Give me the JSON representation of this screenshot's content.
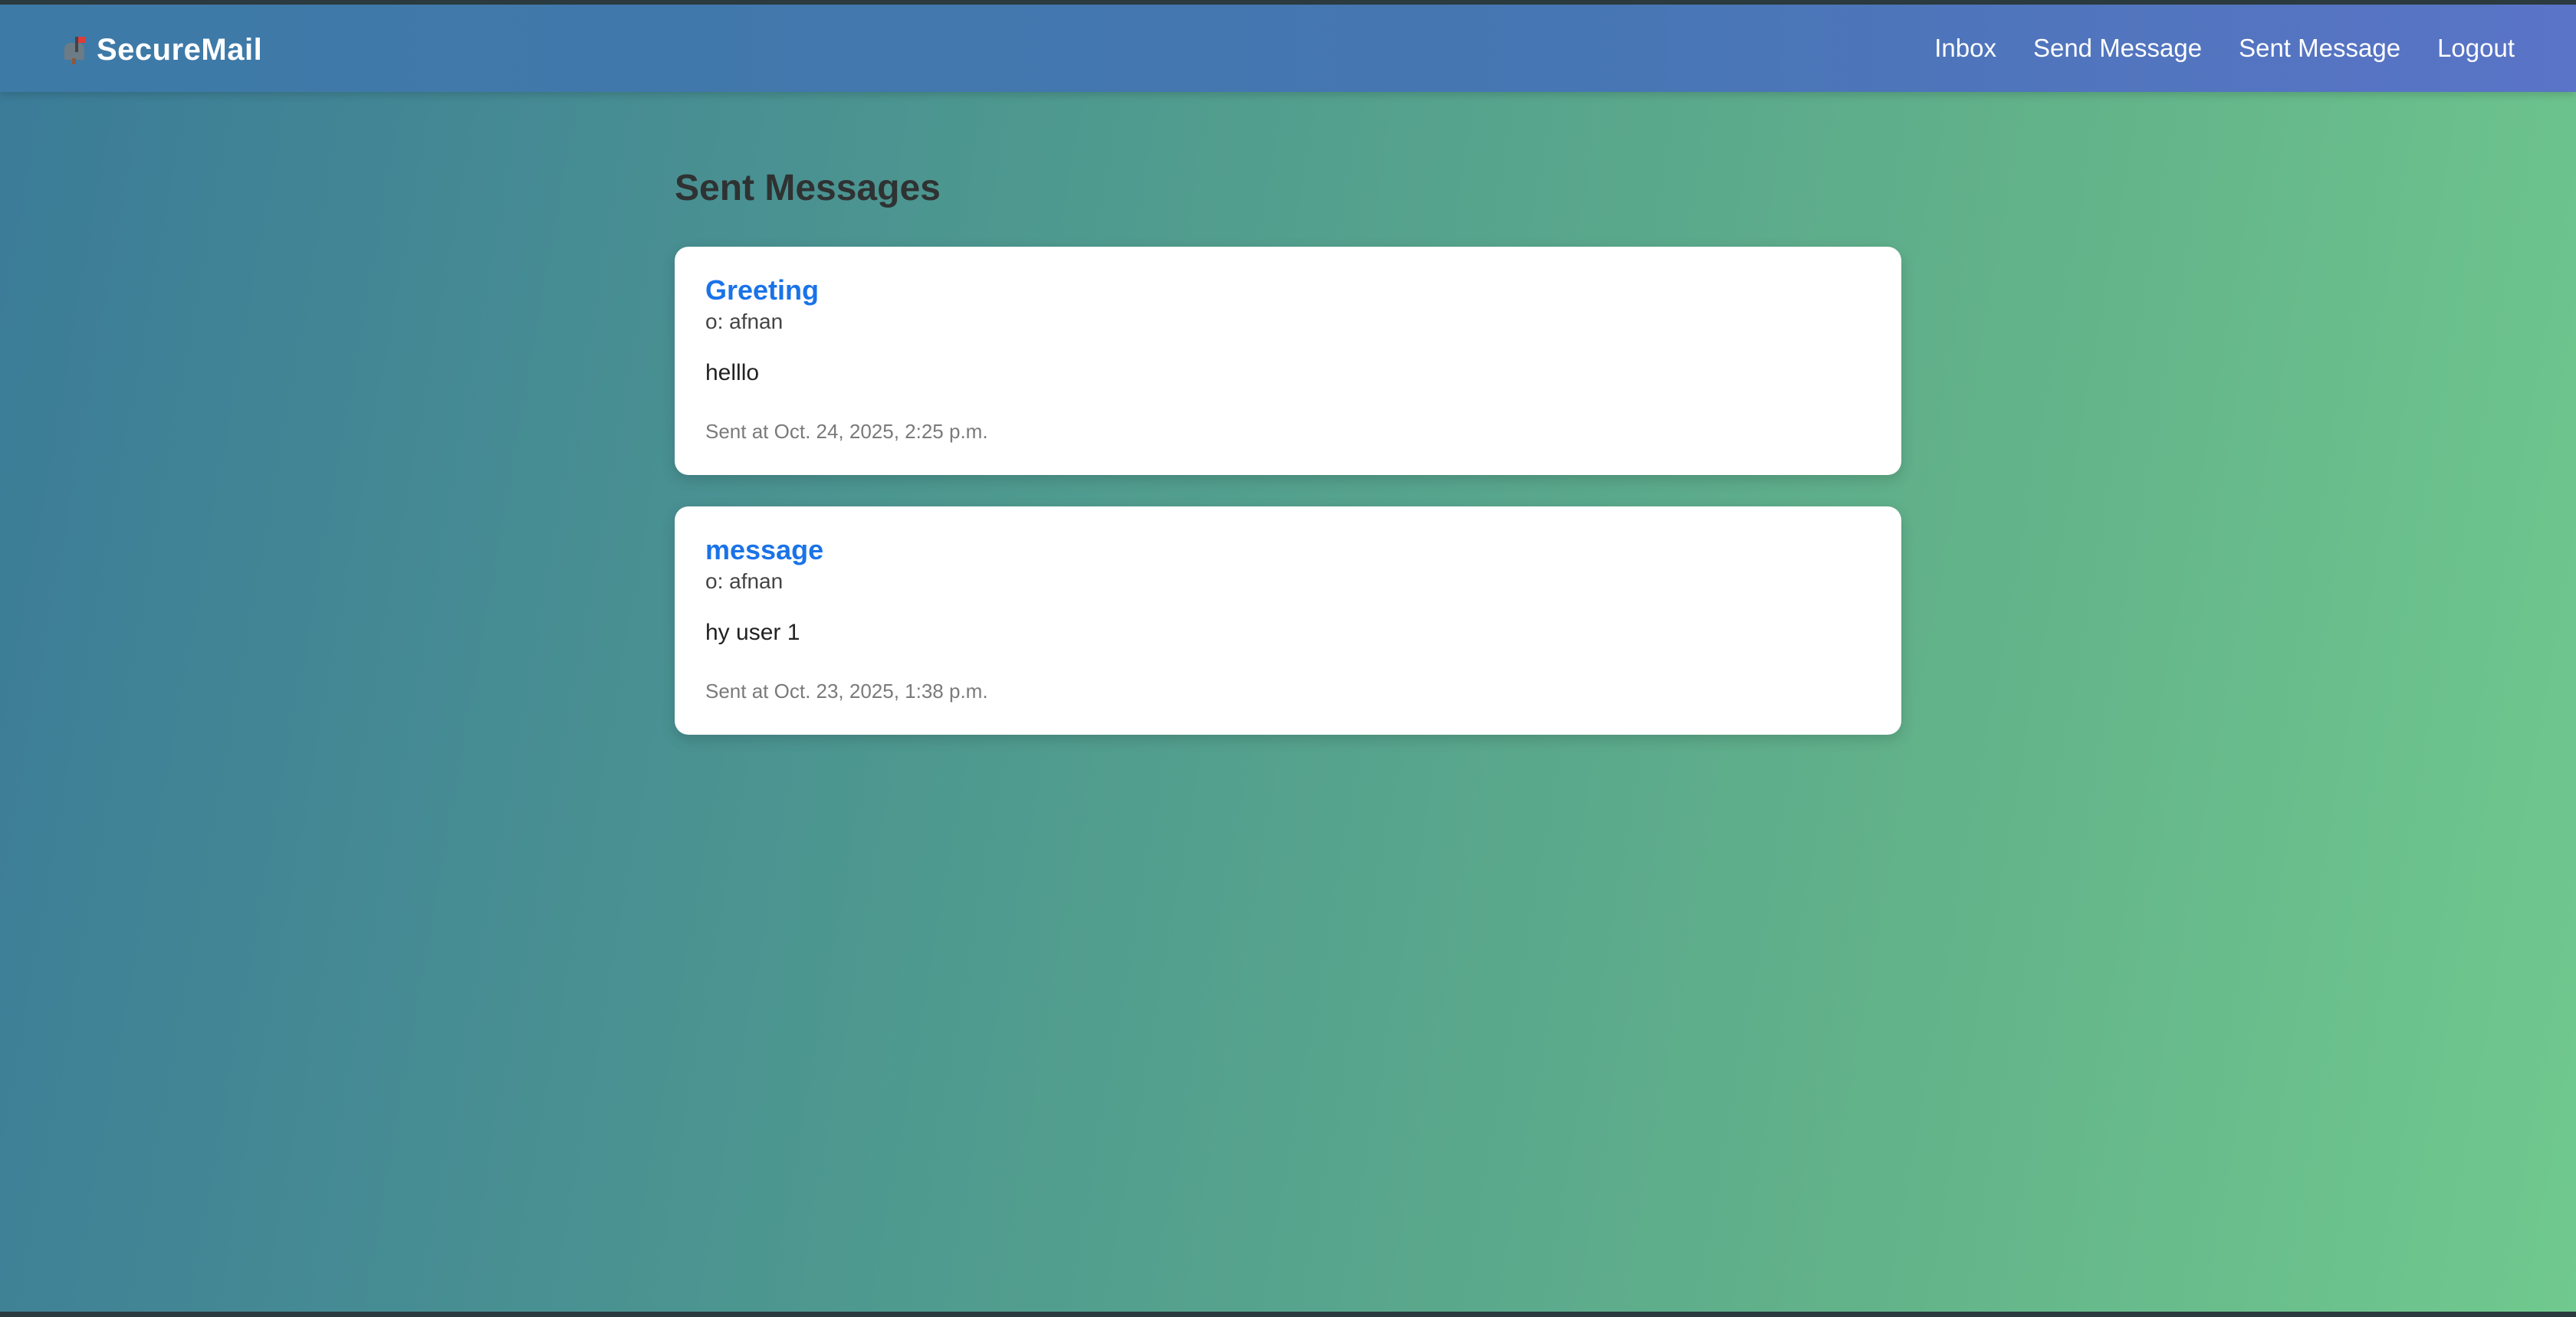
{
  "navbar": {
    "brand_icon": "mailbox-icon",
    "brand_name": "SecureMail",
    "links": [
      {
        "label": "Inbox"
      },
      {
        "label": "Send Message"
      },
      {
        "label": "Sent Message"
      },
      {
        "label": "Logout"
      }
    ]
  },
  "page": {
    "title": "Sent Messages"
  },
  "messages": [
    {
      "subject": "Greeting",
      "recipient": "o: afnan",
      "body": "helllo",
      "sent_at": "Sent at Oct. 24, 2025, 2:25 p.m."
    },
    {
      "subject": "message",
      "recipient": "o: afnan",
      "body": "hy user 1",
      "sent_at": "Sent at Oct. 23, 2025, 1:38 p.m."
    }
  ],
  "colors": {
    "subject_link": "#1a73e8",
    "navbar_start": "#3d7aa6",
    "navbar_end": "#5a74c7",
    "background_start": "#3b7b98",
    "background_end": "#70c98e"
  }
}
